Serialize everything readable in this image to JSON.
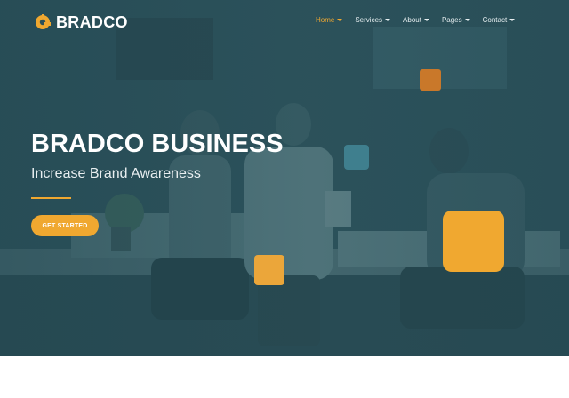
{
  "brand": {
    "name": "BRADCO",
    "accent": "#f0a830",
    "logo_icon": "gear-logo-icon"
  },
  "nav": {
    "items": [
      {
        "label": "Home",
        "active": true
      },
      {
        "label": "Services",
        "active": false
      },
      {
        "label": "About",
        "active": false
      },
      {
        "label": "Pages",
        "active": false
      },
      {
        "label": "Contact",
        "active": false
      }
    ],
    "dropdown_icon": "caret-down-icon"
  },
  "hero": {
    "title": "BRADCO BUSINESS",
    "subtitle": "Increase Brand Awareness",
    "cta_label": "GET STARTED",
    "overlay_color": "#214650"
  },
  "decor_colors": [
    "#c9782a",
    "#3f7f8e",
    "#f0a830",
    "#eba63a"
  ]
}
